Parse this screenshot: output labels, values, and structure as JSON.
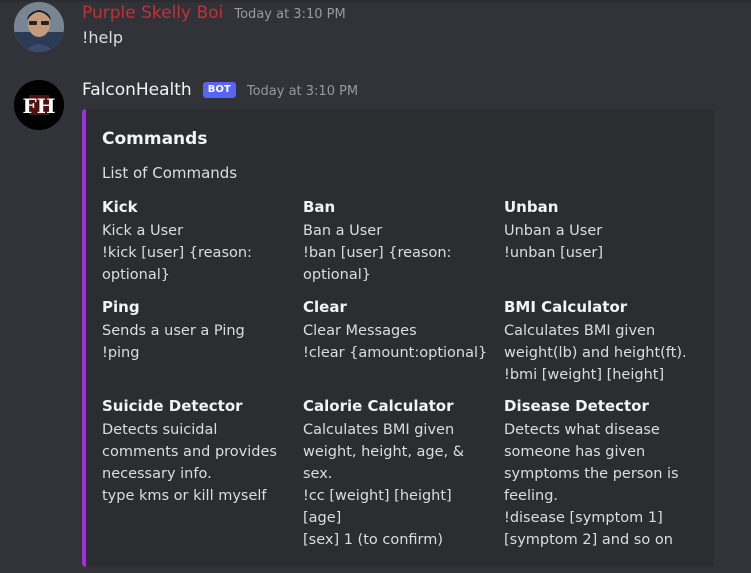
{
  "messages": [
    {
      "username": "Purple Skelly Boi",
      "timestamp": "Today at 3:10 PM",
      "content": "!help"
    },
    {
      "username": "FalconHealth",
      "bot_tag": "BOT",
      "timestamp": "Today at 3:10 PM",
      "embed": {
        "accent_color": "#a12ee0",
        "title": "Commands",
        "description": "List of Commands",
        "fields": [
          {
            "name": "Kick",
            "value": "Kick a User\n!kick [user] {reason:\noptional}"
          },
          {
            "name": "Ban",
            "value": "Ban a User\n!ban [user] {reason:\noptional}"
          },
          {
            "name": "Unban",
            "value": "Unban a User\n!unban [user]"
          },
          {
            "name": "Ping",
            "value": "Sends a user a Ping\n!ping"
          },
          {
            "name": "Clear",
            "value": "Clear Messages\n!clear {amount:optional}"
          },
          {
            "name": "BMI Calculator",
            "value": "Calculates BMI given\nweight(lb) and height(ft).\n!bmi [weight] [height]"
          },
          {
            "name": "Suicide Detector",
            "value": "Detects suicidal\ncomments and provides\nnecessary info.\ntype kms or kill myself"
          },
          {
            "name": "Calorie Calculator",
            "value": "Calculates BMI given\nweight, height, age, & sex.\n!cc [weight] [height] [age]\n[sex] 1 (to confirm)"
          },
          {
            "name": "Disease Detector",
            "value": "Detects what disease\nsomeone has given\nsymptoms the person is\nfeeling.\n!disease [symptom 1]\n[symptom 2] and so on"
          }
        ]
      }
    }
  ],
  "colors": {
    "background": "#313338",
    "embed_background": "#2b2d31",
    "username_1": "#c03237",
    "bot_tag": "#5865f2"
  }
}
